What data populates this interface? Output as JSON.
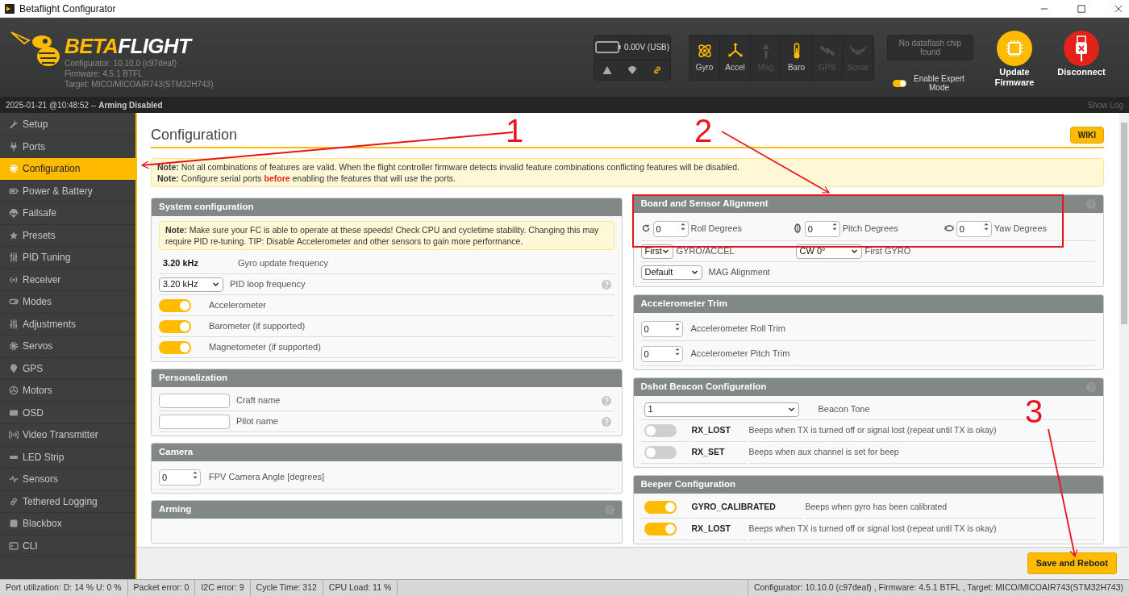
{
  "window": {
    "title": "Betaflight Configurator"
  },
  "header": {
    "logo": {
      "accent": "BETA",
      "rest": "FLIGHT"
    },
    "versions": [
      "Configurator: 10.10.0 (c97deaf)",
      "Firmware: 4.5.1 BTFL",
      "Target: MICO/MICOAIR743(STM32H743)"
    ],
    "battery": {
      "reading": "0.00V (USB)"
    },
    "sensors": [
      {
        "label": "Gyro",
        "active": true
      },
      {
        "label": "Accel",
        "active": true
      },
      {
        "label": "Mag",
        "active": false
      },
      {
        "label": "Baro",
        "active": true
      },
      {
        "label": "GPS",
        "active": false
      },
      {
        "label": "Sonar",
        "active": false
      }
    ],
    "dataflash": "No dataflash chip found",
    "expert_mode": {
      "label": "Enable Expert Mode",
      "on": true
    },
    "actions": [
      {
        "kind": "update",
        "label": "Update Firmware"
      },
      {
        "kind": "disconnect",
        "label": "Disconnect"
      }
    ]
  },
  "status_strip": {
    "text": "2025-01-21 @10:48:52 -- **Arming Disabled**",
    "show_log": "Show Log"
  },
  "sidebar": {
    "items": [
      {
        "label": "Setup",
        "selected": false
      },
      {
        "label": "Ports",
        "selected": false
      },
      {
        "label": "Configuration",
        "selected": true
      },
      {
        "label": "Power & Battery",
        "selected": false
      },
      {
        "label": "Failsafe",
        "selected": false
      },
      {
        "label": "Presets",
        "selected": false
      },
      {
        "label": "PID Tuning",
        "selected": false
      },
      {
        "label": "Receiver",
        "selected": false
      },
      {
        "label": "Modes",
        "selected": false
      },
      {
        "label": "Adjustments",
        "selected": false
      },
      {
        "label": "Servos",
        "selected": false
      },
      {
        "label": "GPS",
        "selected": false
      },
      {
        "label": "Motors",
        "selected": false
      },
      {
        "label": "OSD",
        "selected": false
      },
      {
        "label": "Video Transmitter",
        "selected": false
      },
      {
        "label": "LED Strip",
        "selected": false
      },
      {
        "label": "Sensors",
        "selected": false
      },
      {
        "label": "Tethered Logging",
        "selected": false
      },
      {
        "label": "Blackbox",
        "selected": false
      },
      {
        "label": "CLI",
        "selected": false
      }
    ]
  },
  "content": {
    "title": "Configuration",
    "wiki": "WIKI",
    "notes": [
      "**Note:** Not all combinations of features are valid. When the flight controller firmware detects invalid feature combinations conflicting features will be disabled.",
      "**Note:** Configure serial ports **before** enabling the features that will use the ports."
    ],
    "left_panels": [
      {
        "title": "System configuration",
        "rows": [
          {
            "kind": "note",
            "text": "**Note:** Make sure your FC is able to operate at these speeds! Check CPU and cycletime stability. Changing this may require PID re-tuning. TIP: Disable Accelerometer and other sensors to gain more performance."
          },
          {
            "kind": "value",
            "value": "3.20 kHz",
            "label": "Gyro update frequency"
          },
          {
            "kind": "select",
            "value": "3.20 kHz",
            "label": "PID loop frequency",
            "help": true
          },
          {
            "kind": "toggle",
            "on": true,
            "label": "Accelerometer"
          },
          {
            "kind": "toggle",
            "on": true,
            "label": "Barometer (if supported)"
          },
          {
            "kind": "toggle",
            "on": true,
            "label": "Magnetometer (if supported)"
          }
        ]
      },
      {
        "title": "Personalization",
        "rows": [
          {
            "kind": "input",
            "label": "Craft name",
            "help": true
          },
          {
            "kind": "input",
            "label": "Pilot name",
            "help": true
          }
        ]
      },
      {
        "title": "Camera",
        "rows": [
          {
            "kind": "spin",
            "value": "0",
            "label": "FPV Camera Angle [degrees]"
          }
        ]
      },
      {
        "title": "Arming",
        "help": true
      }
    ],
    "right_panels": [
      {
        "title": "Board and Sensor Alignment",
        "help": true,
        "rows": [
          {
            "kind": "alignment",
            "items": [
              {
                "value": "0",
                "caption": "Roll Degrees"
              },
              {
                "value": "0",
                "caption": "Pitch Degrees"
              },
              {
                "value": "0",
                "caption": "Yaw Degrees"
              }
            ]
          },
          {
            "kind": "select_pair",
            "items": [
              {
                "value": "First",
                "caption": "GYRO/ACCEL"
              },
              {
                "value": "CW 0°",
                "caption": "First GYRO"
              }
            ]
          },
          {
            "kind": "select",
            "value": "Default",
            "label": "MAG Alignment"
          }
        ]
      },
      {
        "title": "Accelerometer Trim",
        "rows": [
          {
            "kind": "spin",
            "value": "0",
            "label": "Accelerometer Roll Trim"
          },
          {
            "kind": "spin",
            "value": "0",
            "label": "Accelerometer Pitch Trim"
          }
        ]
      },
      {
        "title": "Dshot Beacon Configuration",
        "help": true,
        "rows": [
          {
            "kind": "wide_select",
            "value": "1",
            "label": "Beacon Tone"
          },
          {
            "kind": "beep",
            "on": false,
            "name": "RX_LOST",
            "description": "Beeps when TX is turned off or signal lost (repeat until TX is okay)"
          },
          {
            "kind": "beep",
            "on": false,
            "name": "RX_SET",
            "description": "Beeps when aux channel is set for beep"
          }
        ]
      },
      {
        "title": "Beeper Configuration",
        "rows": [
          {
            "kind": "beep",
            "on": true,
            "name": "GYRO_CALIBRATED",
            "description": "Beeps when gyro has been calibrated"
          },
          {
            "kind": "beep",
            "on": true,
            "name": "RX_LOST",
            "description": "Beeps when TX is turned off or signal lost (repeat until TX is okay)"
          }
        ]
      }
    ]
  },
  "footer": {
    "button": "Save and Reboot"
  },
  "status_bar": {
    "cells": [
      "Port utilization: D: 14 % U: 0 %",
      "Packet error: 0",
      "I2C error: 9",
      "Cycle Time: 312",
      "CPU Load: 11 %"
    ],
    "version": "Configurator: 10.10.0 (c97deaf) , Firmware: 4.5.1 BTFL , Target: MICO/MICOAIR743(STM32H743)"
  },
  "annotations": [
    {
      "label": "1"
    },
    {
      "label": "2"
    },
    {
      "label": "3"
    }
  ]
}
